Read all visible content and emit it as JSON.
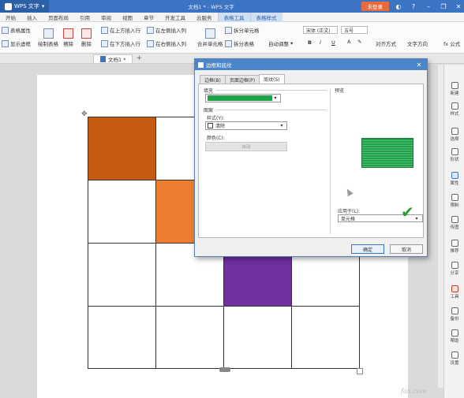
{
  "app": {
    "name": "WPS 文字",
    "window_title": "文档1 * - WPS 文字",
    "login_label": "未登录"
  },
  "menu_tabs": [
    "开始",
    "插入",
    "页面布局",
    "引用",
    "审阅",
    "视图",
    "章节",
    "开发工具",
    "云服务",
    "表格工具",
    "表格样式"
  ],
  "ribbon": {
    "table_props": "表格属性",
    "show_gridlines": "显示虚框",
    "draw_table": "绘制表格",
    "erase": "擦除",
    "delete": "删除",
    "insert_above": "在上方插入行",
    "insert_below": "在下方插入行",
    "insert_left": "在左侧插入列",
    "insert_right": "在右侧插入列",
    "merge_cells": "合并单元格",
    "split_cells": "拆分单元格",
    "split_table": "拆分表格",
    "auto_fit": "自动调整",
    "font_name": "宋体 (正文)",
    "font_size": "五号",
    "bold": "B",
    "italic": "I",
    "underline": "U",
    "align": "对齐方式",
    "text_direction": "文字方向",
    "formula": "fx 公式"
  },
  "doc_tab": {
    "name": "文档1 *"
  },
  "table": {
    "rows": 4,
    "cols": 4,
    "colored_cells": [
      {
        "row": 0,
        "col": 0,
        "color": "#c55a11"
      },
      {
        "row": 1,
        "col": 1,
        "color": "#ed7d31"
      },
      {
        "row": 2,
        "col": 2,
        "color": "#7030a0"
      }
    ]
  },
  "sidebar": [
    {
      "label": "新建",
      "icon": "new-icon"
    },
    {
      "label": "样式",
      "icon": "style-icon"
    },
    {
      "label": "选择",
      "icon": "select-icon"
    },
    {
      "label": "形状",
      "icon": "shape-icon"
    },
    {
      "label": "属性",
      "icon": "property-icon"
    },
    {
      "label": "限制",
      "icon": "restrict-icon"
    },
    {
      "label": "传图",
      "icon": "image-icon"
    },
    {
      "label": "推荐",
      "icon": "recommend-icon"
    },
    {
      "label": "分享",
      "icon": "share-icon"
    },
    {
      "label": "工具",
      "icon": "tools-icon"
    },
    {
      "label": "备份",
      "icon": "backup-icon"
    },
    {
      "label": "帮助",
      "icon": "help-icon"
    },
    {
      "label": "设置",
      "icon": "settings-icon"
    }
  ],
  "dialog": {
    "title": "边框和底纹",
    "tabs": [
      "边框(B)",
      "页面边框(P)",
      "底纹(S)"
    ],
    "active_tab": "底纹(S)",
    "fill_label": "填充",
    "fill_color": "#1fa34a",
    "pattern_label": "图案",
    "style_label": "样式(Y):",
    "style_value": "清除",
    "color_label": "颜色(C):",
    "color_value": "自动",
    "preview_label": "预览",
    "apply_label": "应用于(L):",
    "apply_value": "单元格",
    "ok_label": "确定",
    "cancel_label": "取消"
  },
  "watermark": "fan.com"
}
